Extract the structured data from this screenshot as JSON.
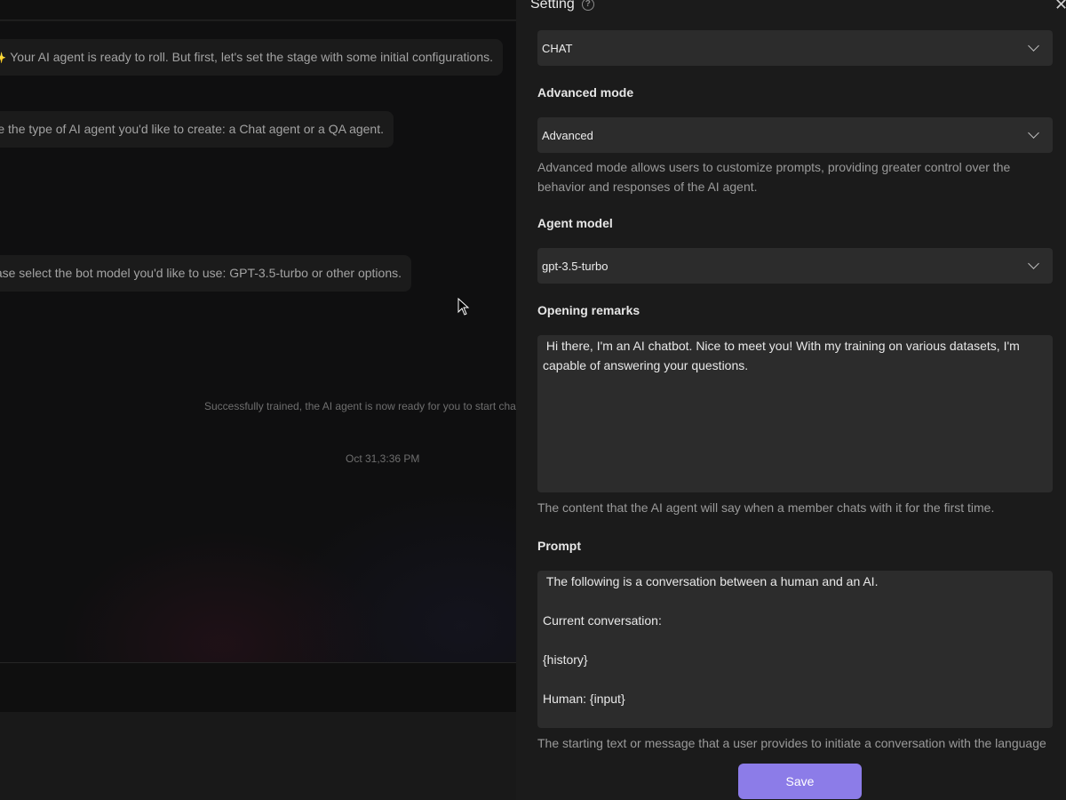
{
  "chat": {
    "messages": [
      {
        "emoji": "✨",
        "text": "Your AI agent is ready to roll. But first, let's set the stage with some initial configurations."
      },
      {
        "text": "e the type of AI agent you'd like to create: a Chat agent or a QA agent."
      },
      {
        "text": "ase select the bot model you'd like to use: GPT-3.5-turbo or other options."
      }
    ],
    "system_note": "Successfully trained, the AI agent is now ready for you to start cha",
    "timestamp": "Oct 31,3:36 PM"
  },
  "panel": {
    "title": "Setting",
    "help_icon": "question-circle-icon",
    "close_icon": "close-icon",
    "agent_type": {
      "value": "CHAT"
    },
    "advanced_mode": {
      "label": "Advanced mode",
      "value": "Advanced",
      "hint": "Advanced mode allows users to customize prompts, providing greater control over the behavior and responses of the AI agent."
    },
    "agent_model": {
      "label": "Agent model",
      "value": "gpt-3.5-turbo"
    },
    "opening_remarks": {
      "label": "Opening remarks",
      "value": " Hi there, I'm an AI chatbot. Nice to meet you! With my training on various datasets, I'm capable of answering your questions.",
      "hint": "The content that the AI agent will say when a member chats with it for the first time."
    },
    "prompt": {
      "label": "Prompt",
      "value": " The following is a conversation between a human and an AI.\n\nCurrent conversation:\n\n{history}\n\nHuman: {input}",
      "hint": "The starting text or message that a user provides to initiate a conversation with the language"
    },
    "save_label": "Save"
  },
  "colors": {
    "accent": "#8c7ce8",
    "panel_bg": "#1b1b1b",
    "input_bg": "#2c2c2c",
    "chat_bg": "#0f0f10"
  }
}
